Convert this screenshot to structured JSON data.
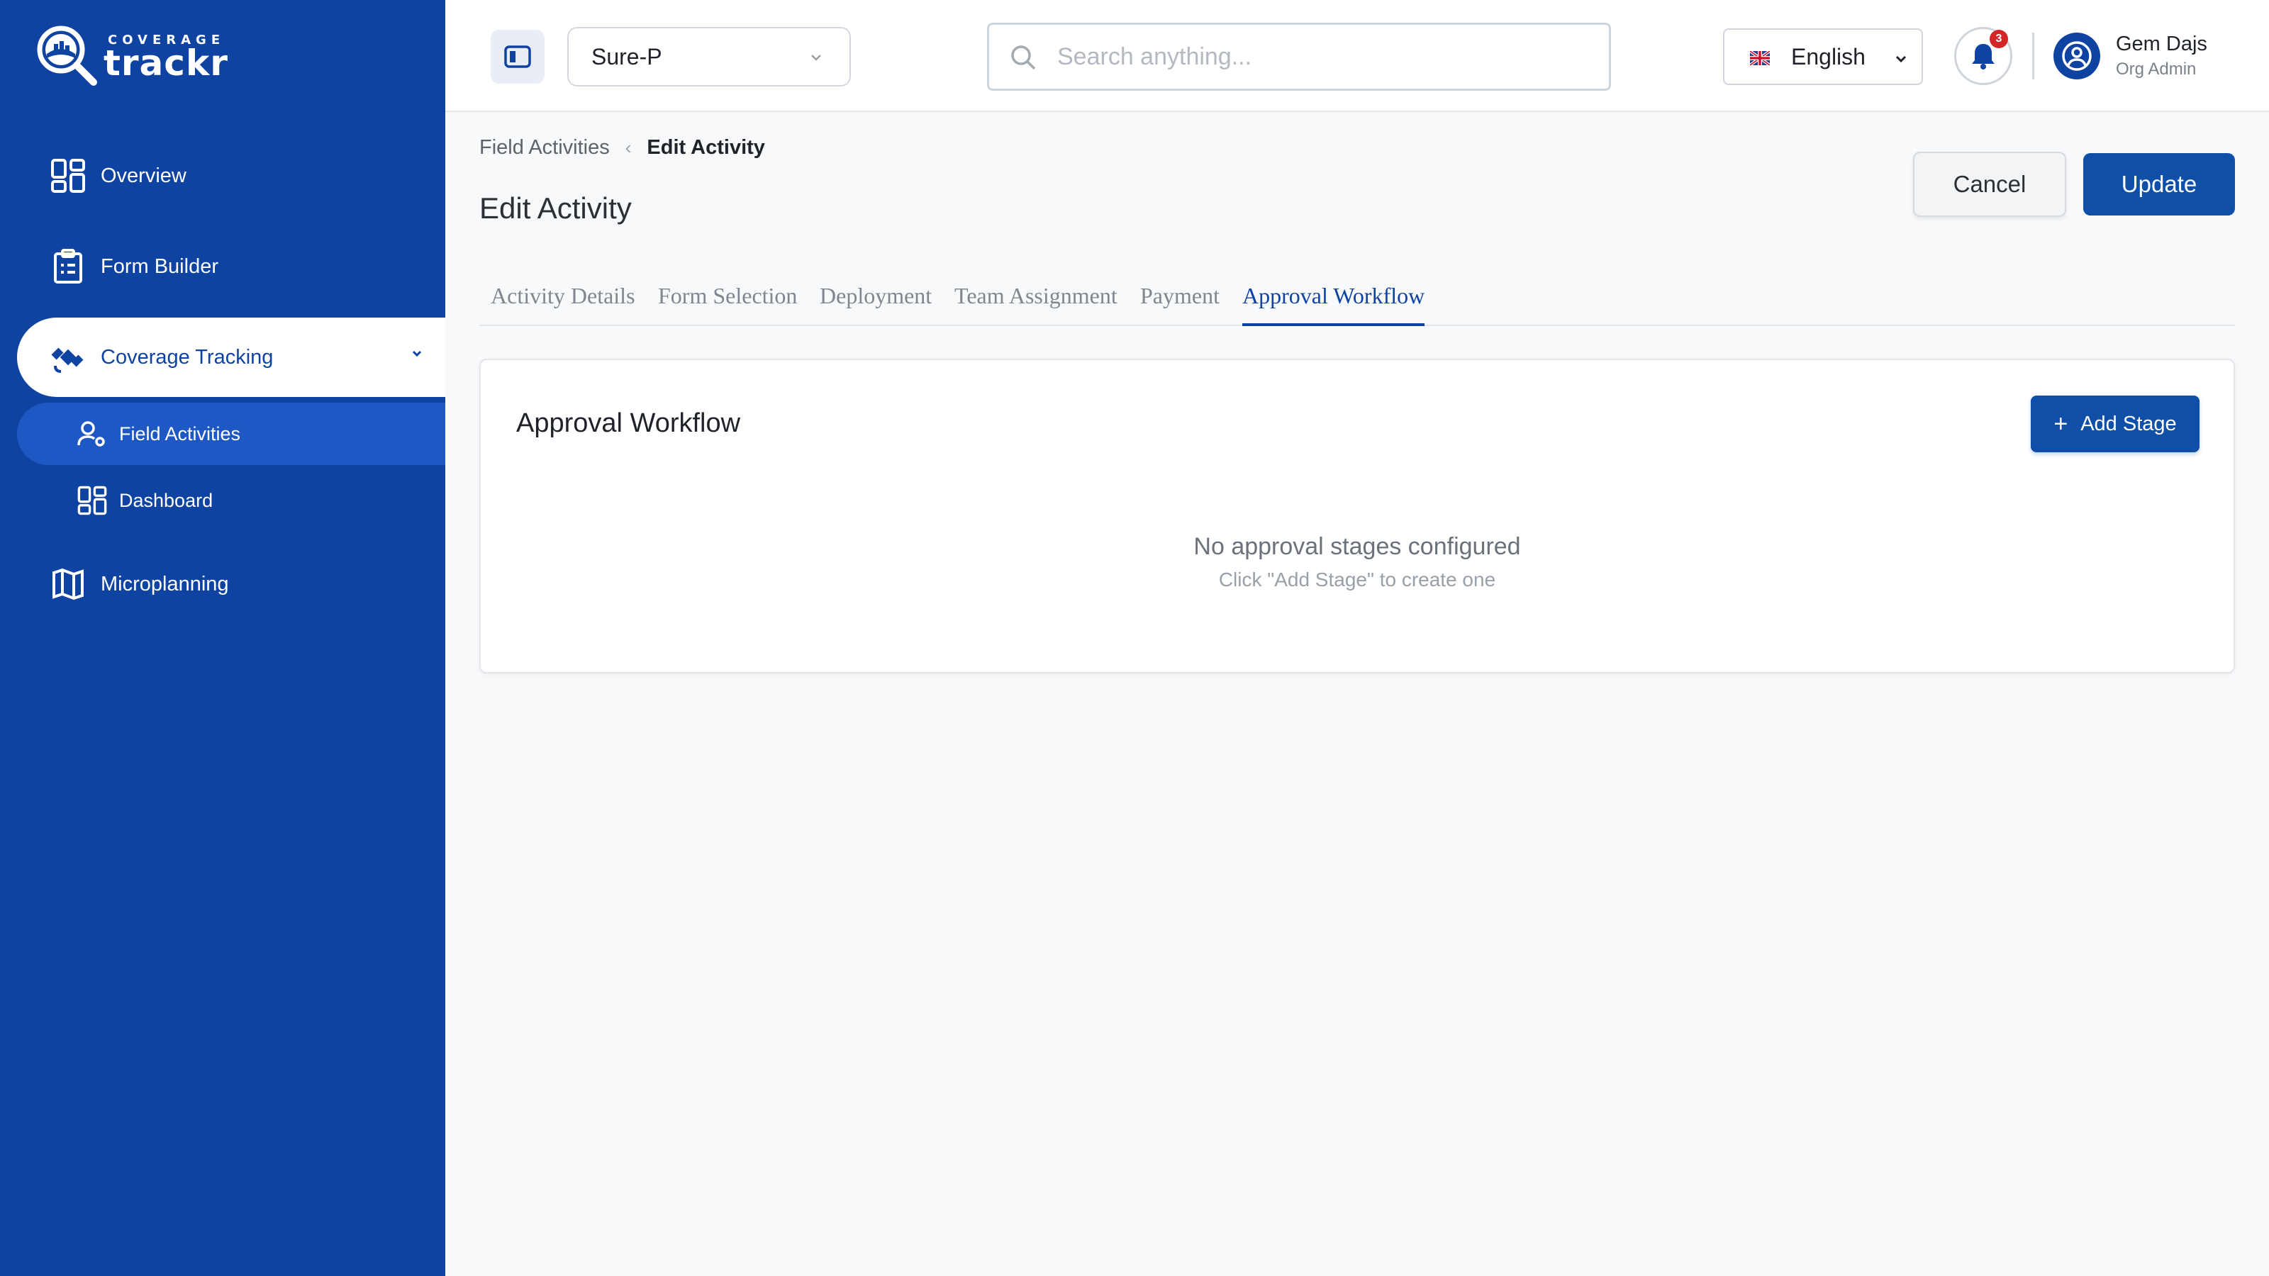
{
  "brand": {
    "sub": "COVERAGE",
    "main": "trackr"
  },
  "sidebar": {
    "items": [
      {
        "label": "Overview",
        "icon": "grid-icon"
      },
      {
        "label": "Form Builder",
        "icon": "clipboard-icon"
      },
      {
        "label": "Coverage Tracking",
        "icon": "satellite-icon",
        "expanded": true,
        "children": [
          {
            "label": "Field Activities",
            "icon": "user-gear-icon",
            "selected": true
          },
          {
            "label": "Dashboard",
            "icon": "grid-icon"
          }
        ]
      },
      {
        "label": "Microplanning",
        "icon": "map-icon"
      }
    ]
  },
  "header": {
    "org_select": "Sure-P",
    "search_placeholder": "Search anything...",
    "language": "English",
    "notifications_count": "3",
    "user_name": "Gem Dajs",
    "user_role": "Org Admin"
  },
  "breadcrumb": {
    "parent": "Field Activities",
    "current": "Edit Activity"
  },
  "page": {
    "title": "Edit Activity",
    "cancel_label": "Cancel",
    "update_label": "Update"
  },
  "tabs": [
    {
      "label": "Activity Details"
    },
    {
      "label": "Form Selection"
    },
    {
      "label": "Deployment"
    },
    {
      "label": "Team Assignment"
    },
    {
      "label": "Payment"
    },
    {
      "label": "Approval Workflow",
      "active": true
    }
  ],
  "approval": {
    "title": "Approval Workflow",
    "add_label": "Add Stage",
    "empty_title": "No approval stages configured",
    "empty_hint": "Click \"Add Stage\" to create one"
  },
  "colors": {
    "primary": "#0f43a2",
    "button": "#0f4fa8",
    "badge": "#d42626"
  }
}
